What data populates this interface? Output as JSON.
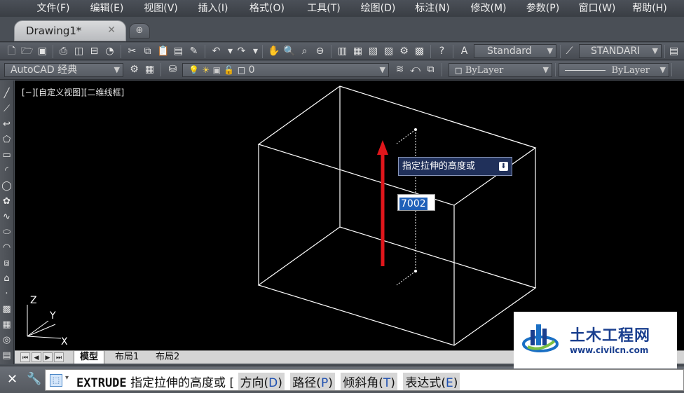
{
  "menu": [
    "文件(F)",
    "编辑(E)",
    "视图(V)",
    "插入(I)",
    "格式(O)",
    "工具(T)",
    "绘图(D)",
    "标注(N)",
    "修改(M)",
    "参数(P)",
    "窗口(W)",
    "帮助(H)"
  ],
  "document_tab": {
    "title": "Drawing1*",
    "close": "✕",
    "new_tab": "⊕"
  },
  "toolbar1": {
    "text_style": "Standard",
    "dim_style": "STANDARI"
  },
  "toolbar2": {
    "workspace": "AutoCAD 经典",
    "layer": "0",
    "color": "ByLayer",
    "linetype": "ByLayer"
  },
  "viewport": {
    "label": "[−][自定义视图][二维线框]",
    "ucs_z": "Z",
    "ucs_y": "Y",
    "ucs_x": "X"
  },
  "tooltip": {
    "text": "指定拉伸的高度或"
  },
  "dynamic_input": {
    "value": "7002"
  },
  "layout_tabs": [
    "模型",
    "布局1",
    "布局2"
  ],
  "command_line": {
    "command": "EXTRUDE",
    "prompt": "指定拉伸的高度或",
    "bracket": "[",
    "options": [
      {
        "label": "方向(",
        "key": "D",
        "end": ")"
      },
      {
        "label": "路径(",
        "key": "P",
        "end": ")"
      },
      {
        "label": "倾斜角(",
        "key": "T",
        "end": ")"
      },
      {
        "label": "表达式(",
        "key": "E",
        "end": ")"
      }
    ]
  },
  "watermark": {
    "title": "土木工程网",
    "url": "www.civilcn.com"
  },
  "colors": {
    "canvas": "#000000",
    "arrow": "#e0161b",
    "wire": "#ffffff",
    "tooltip_bg": "#20305a"
  }
}
